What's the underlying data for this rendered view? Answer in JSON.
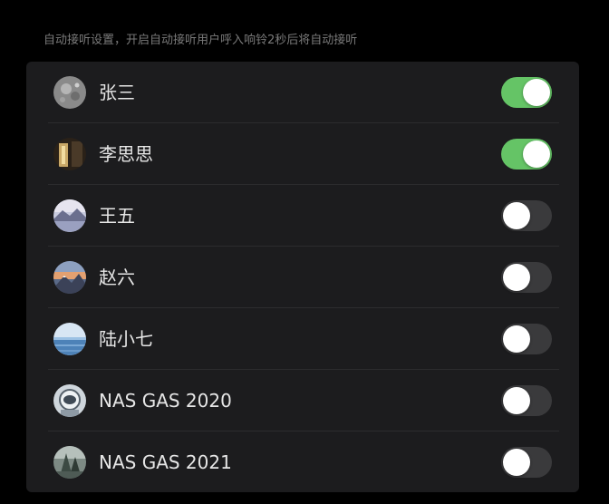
{
  "header": {
    "hint": "自动接听设置，开启自动接听用户呼入响铃2秒后将自动接听"
  },
  "contacts": [
    {
      "name": "张三",
      "avatar_icon": "moon-photo-avatar",
      "auto_answer": true
    },
    {
      "name": "李思思",
      "avatar_icon": "doorway-photo-avatar",
      "auto_answer": true
    },
    {
      "name": "王五",
      "avatar_icon": "mountain-lake-avatar",
      "auto_answer": false
    },
    {
      "name": "赵六",
      "avatar_icon": "mountain-sunset-avatar",
      "auto_answer": false
    },
    {
      "name": "陆小七",
      "avatar_icon": "ocean-avatar",
      "auto_answer": false
    },
    {
      "name": "NAS GAS 2020",
      "avatar_icon": "astronaut-avatar",
      "auto_answer": false
    },
    {
      "name": "NAS GAS 2021",
      "avatar_icon": "forest-avatar",
      "auto_answer": false
    }
  ],
  "colors": {
    "toggle_on": "#65c466",
    "toggle_off": "#3a3a3c",
    "card": "#1c1c1e",
    "background": "#000000"
  }
}
